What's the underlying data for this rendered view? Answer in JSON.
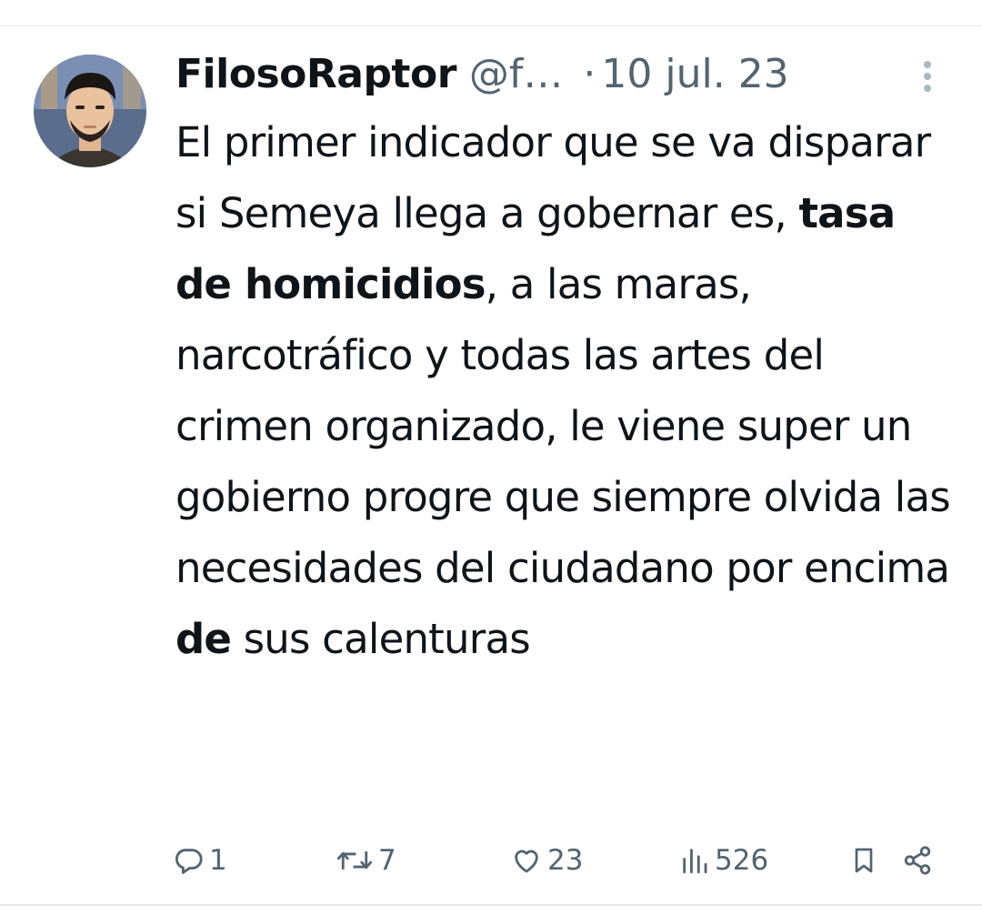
{
  "tweet": {
    "author": {
      "display_name": "FilosoRaptor",
      "handle": "@f…",
      "avatar_icon": "user-avatar-illustration"
    },
    "separator": "·",
    "date": "10 jul. 23",
    "text": {
      "part1": "El primer indicador que se va disparar si Semeya llega a gobernar es, ",
      "bold1": "tasa de homicidios",
      "part2": ", a las maras, narcotráfico y todas las artes del crimen organizado, le viene super un gobierno progre que siempre olvida las necesidades del ciudadano por encima ",
      "bold2": "de",
      "part3": " sus calenturas"
    },
    "actions": {
      "replies": "1",
      "retweets": "7",
      "likes": "23",
      "views": "526"
    },
    "icons": {
      "more": "more-vertical-icon",
      "reply": "reply-icon",
      "retweet": "retweet-icon",
      "like": "heart-icon",
      "views": "views-icon",
      "bookmark": "bookmark-icon",
      "share": "share-icon"
    },
    "colors": {
      "text": "#0f1419",
      "secondary": "#536471"
    }
  }
}
